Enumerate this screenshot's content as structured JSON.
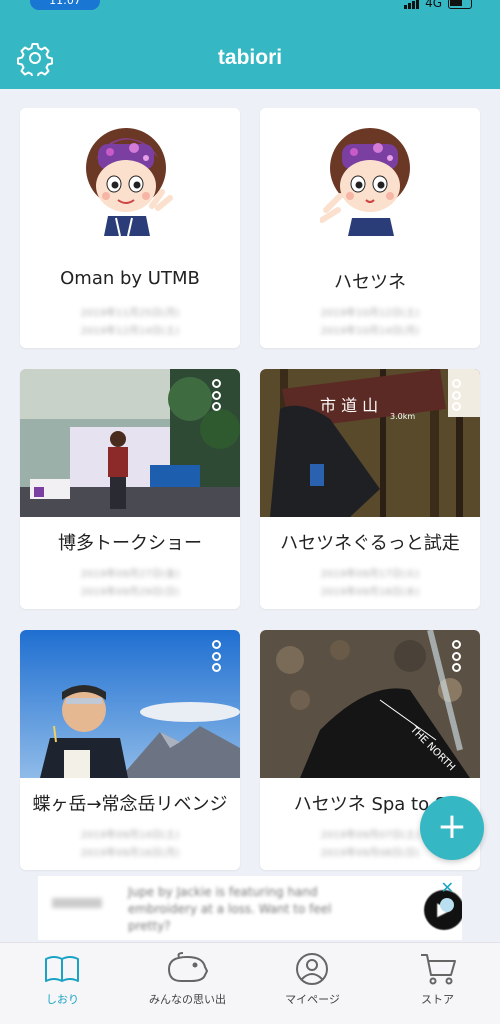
{
  "status_bar": {
    "time": "11:07",
    "network": "4G"
  },
  "header": {
    "title": "tabiori",
    "settings_icon": "gear-icon",
    "background": "#35b7c4"
  },
  "cards": [
    {
      "title": "Oman by UTMB",
      "date1": "2019年11月25日(月)",
      "date2": "2019年12月14日(土)"
    },
    {
      "title": "ハセツネ",
      "date1": "2019年10月12日(土)",
      "date2": "2019年10月14日(月)"
    },
    {
      "title": "博多トークショー",
      "date1": "2019年09月27日(金)",
      "date2": "2019年09月29日(日)"
    },
    {
      "title": "ハセツネぐるっと試走",
      "date1": "2019年09月17日(火)",
      "date2": "2019年09月18日(水)"
    },
    {
      "title": "蝶ヶ岳→常念岳リベンジ",
      "date1": "2019年09月14日(土)",
      "date2": "2019年09月16日(月)"
    },
    {
      "title": "ハセツネ Spa to S",
      "date1": "2019年09月07日(土)",
      "date2": "2019年09月08日(日)"
    }
  ],
  "fab": {
    "label": "+",
    "icon": "plus-icon"
  },
  "ad": {
    "text": "Jupe by Jackie is featuring hand embroidery at a loss. Want to feel pretty?",
    "close": "✕"
  },
  "tabs": [
    {
      "label": "しおり",
      "icon": "book-icon",
      "active": true
    },
    {
      "label": "みんなの思い出",
      "icon": "piggy-bank-icon",
      "active": false
    },
    {
      "label": "マイページ",
      "icon": "user-icon",
      "active": false
    },
    {
      "label": "ストア",
      "icon": "cart-icon",
      "active": false
    }
  ],
  "colors": {
    "accent": "#35b7c4",
    "tab_active": "#1aa3c4",
    "background": "#eef0f7"
  }
}
